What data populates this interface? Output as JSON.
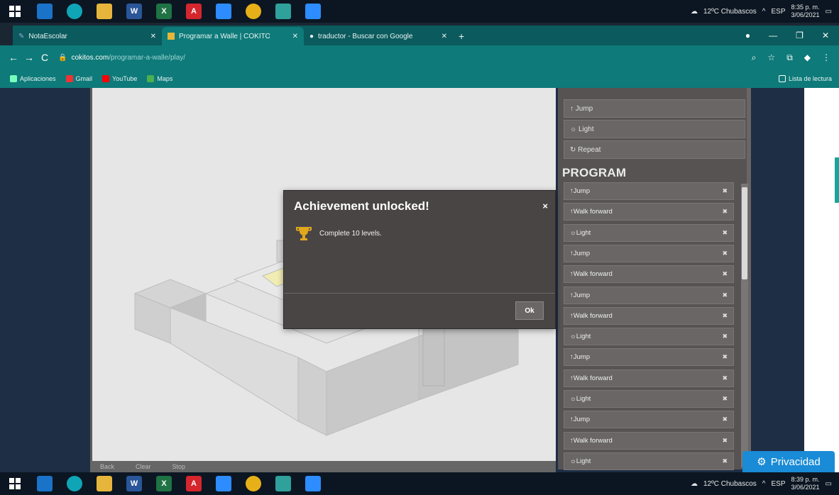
{
  "taskbar": {
    "weather": "12ºC Chubascos",
    "lang": "ESP",
    "time": "8:35 p. m.",
    "date": "3/06/2021",
    "time_bottom": "8:39 p. m.",
    "date_bottom": "3/06/2021"
  },
  "browser": {
    "tabs": [
      {
        "label": "NotaEscolar"
      },
      {
        "label": "Programar a Walle | COKITO"
      },
      {
        "label": "traductor - Buscar con Google"
      }
    ],
    "url_host": "cokitos.com",
    "url_path": "/programar-a-walle/play/",
    "bookmarks": [
      {
        "label": "Aplicaciones"
      },
      {
        "label": "Gmail"
      },
      {
        "label": "YouTube"
      },
      {
        "label": "Maps"
      }
    ],
    "reading_list": "Lista de lectura"
  },
  "commands": [
    {
      "label": "Jump"
    },
    {
      "label": "Light"
    },
    {
      "label": "Repeat"
    }
  ],
  "program": {
    "title": "PROGRAM",
    "items": [
      {
        "label": "Jump"
      },
      {
        "label": "Walk forward"
      },
      {
        "label": "Light"
      },
      {
        "label": "Jump"
      },
      {
        "label": "Walk forward"
      },
      {
        "label": "Jump"
      },
      {
        "label": "Walk forward"
      },
      {
        "label": "Light"
      },
      {
        "label": "Jump"
      },
      {
        "label": "Walk forward"
      },
      {
        "label": "Light"
      },
      {
        "label": "Jump"
      },
      {
        "label": "Walk forward"
      },
      {
        "label": "Light"
      }
    ]
  },
  "modal": {
    "title": "Achievement unlocked!",
    "message": "Complete 10 levels.",
    "ok_label": "Ok",
    "close": "×"
  },
  "stage_bar": {
    "back": "Back",
    "clear": "Clear",
    "stop": "Stop"
  },
  "privacy_label": "Privacidad"
}
